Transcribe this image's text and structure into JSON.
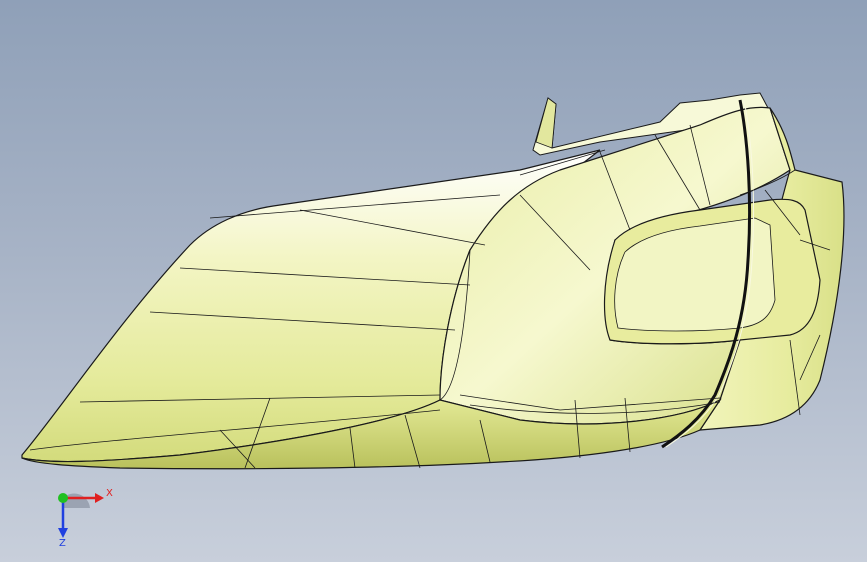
{
  "viewport": {
    "background_top": "#8fa0b8",
    "background_bottom": "#c8cfdb"
  },
  "model": {
    "surface_color": "#eef2b0",
    "surface_highlight": "#ffffff",
    "surface_shadow": "#c8d070",
    "edge_color": "#1a1a1a"
  },
  "triad": {
    "x_label": "X",
    "z_label": "Z",
    "x_color": "#e02020",
    "y_color": "#20c020",
    "z_color": "#2040e0"
  }
}
